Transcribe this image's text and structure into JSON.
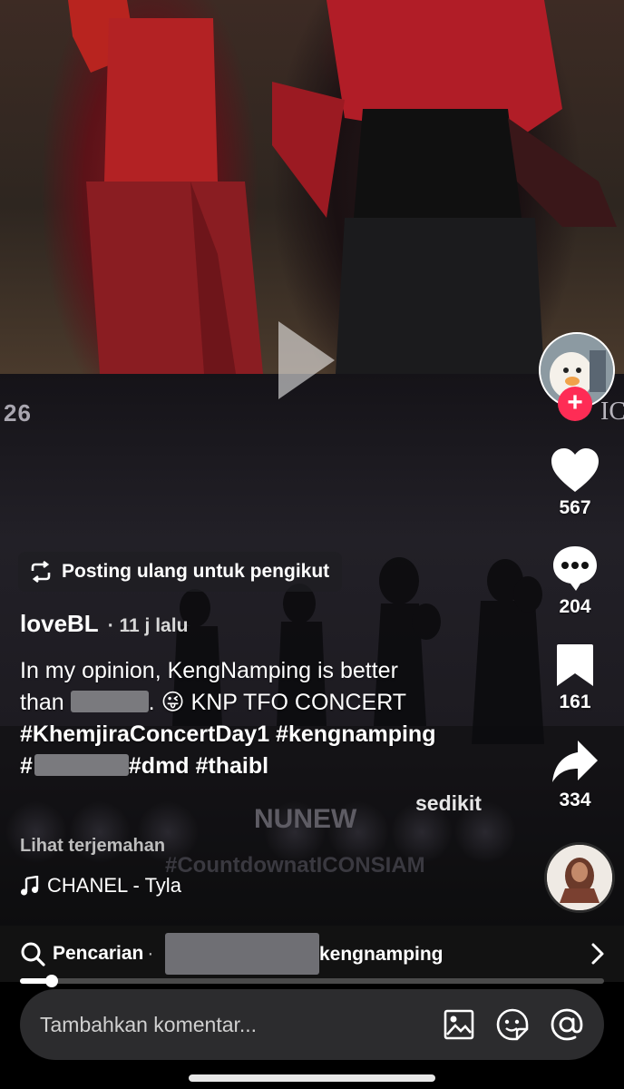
{
  "video": {
    "frame_number": "26",
    "frame_corner_text": "IC",
    "overlay_name": "NUNEW",
    "overlay_hashtag": "#CountdownatICONSIAM"
  },
  "rail": {
    "like_count": "567",
    "comment_count": "204",
    "save_count": "161",
    "share_count": "334",
    "follow_symbol": "+"
  },
  "repost": {
    "label": "Posting ulang untuk pengikut"
  },
  "author": {
    "name": "loveBL",
    "time": "· 11 j lalu"
  },
  "caption": {
    "line1": "In my opinion, KengNamping is better",
    "line2_pre": "than",
    "line2_post": ". 😜 KNP TFO CONCERT",
    "line3": "#KhemjiraConcertDay1 #kengnamping",
    "line4_pre": "#",
    "line4_post": "#dmd #thaibl",
    "more_label": "sedikit",
    "translate_label": "Lihat terjemahan"
  },
  "music": {
    "title": "CHANEL - Tyla"
  },
  "search": {
    "label": "Pencarian",
    "separator": "·",
    "term": "kengnamping"
  },
  "progress": {
    "fraction": 0.055
  },
  "comment": {
    "placeholder": "Tambahkan komentar..."
  },
  "colors": {
    "accent": "#fe2c55",
    "background": "#000000",
    "input_bg": "#2c2c2e"
  }
}
